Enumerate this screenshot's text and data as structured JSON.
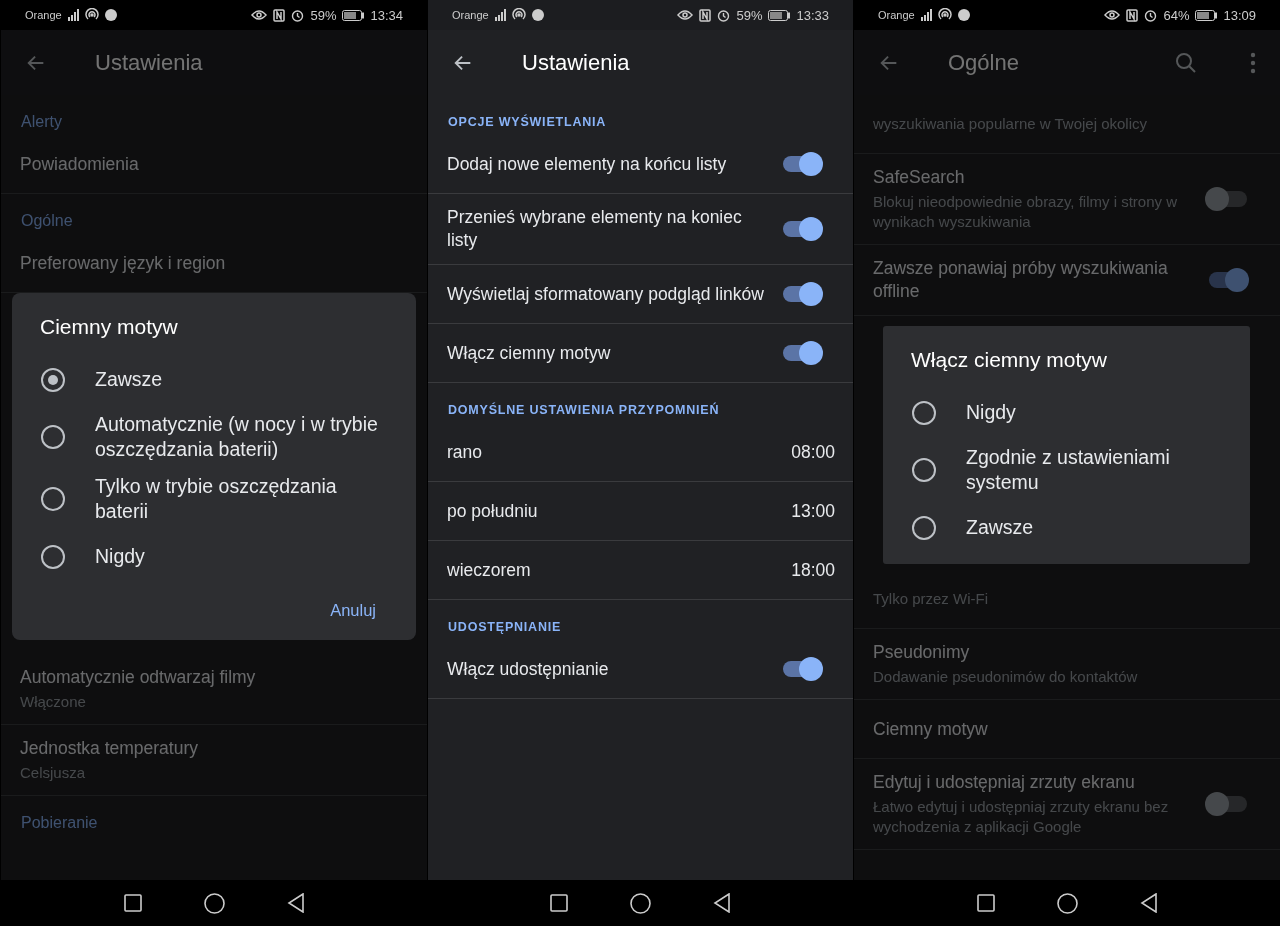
{
  "screens": [
    {
      "dimmed": true,
      "status_bar": {
        "carrier": "Orange",
        "battery": "59%",
        "time": "13:34"
      },
      "app_bar": {
        "title": "Ustawienia"
      },
      "items": [
        {
          "kind": "header",
          "label": "Alerty"
        },
        {
          "kind": "item",
          "title": "Powiadomienia"
        },
        {
          "kind": "header",
          "label": "Ogólne"
        },
        {
          "kind": "item",
          "title": "Preferowany język i region"
        },
        {
          "kind": "dialog",
          "title": "Ciemny motyw",
          "options": [
            {
              "label": "Zawsze",
              "selected": true
            },
            {
              "label": "Automatycznie (w nocy i w trybie oszczędzania baterii)",
              "selected": false
            },
            {
              "label": "Tylko w trybie oszczędzania baterii",
              "selected": false
            },
            {
              "label": "Nigdy",
              "selected": false
            }
          ],
          "buttons": [
            "Anuluj"
          ]
        },
        {
          "kind": "item",
          "title": "Automatycznie odtwarzaj filmy",
          "subtitle": "Włączone"
        },
        {
          "kind": "item",
          "title": "Jednostka temperatury",
          "subtitle": "Celsjusza"
        },
        {
          "kind": "header",
          "label": "Pobieranie"
        }
      ]
    },
    {
      "dimmed": false,
      "status_bar": {
        "carrier": "Orange",
        "battery": "59%",
        "time": "13:33"
      },
      "app_bar": {
        "title": "Ustawienia"
      },
      "items": [
        {
          "kind": "caps_header",
          "label": "OPCJE WYŚWIETLANIA"
        },
        {
          "kind": "toggle",
          "title": "Dodaj nowe elementy na końcu listy",
          "on": true
        },
        {
          "kind": "toggle",
          "title": "Przenieś wybrane elementy na koniec listy",
          "on": true
        },
        {
          "kind": "toggle",
          "title": "Wyświetlaj sformatowany podgląd linków",
          "on": true
        },
        {
          "kind": "toggle",
          "title": "Włącz ciemny motyw",
          "on": true
        },
        {
          "kind": "caps_header",
          "label": "DOMYŚLNE USTAWIENIA PRZYPOMNIEŃ"
        },
        {
          "kind": "value",
          "title": "rano",
          "value": "08:00"
        },
        {
          "kind": "value",
          "title": "po południu",
          "value": "13:00"
        },
        {
          "kind": "value",
          "title": "wieczorem",
          "value": "18:00"
        },
        {
          "kind": "caps_header",
          "label": "UDOSTĘPNIANIE"
        },
        {
          "kind": "toggle",
          "title": "Włącz udostępnianie",
          "on": true
        }
      ]
    },
    {
      "dimmed": true,
      "status_bar": {
        "carrier": "Orange",
        "battery": "64%",
        "time": "13:09"
      },
      "app_bar": {
        "title": "Ogólne",
        "actions": [
          {
            "kind": "search"
          },
          {
            "kind": "menu"
          }
        ]
      },
      "items": [
        {
          "kind": "item",
          "subtitle": "wyszukiwania popularne w Twojej okolicy"
        },
        {
          "kind": "toggle",
          "title": "SafeSearch",
          "subtitle": "Blokuj nieodpowiednie obrazy, filmy i strony w wynikach wyszukiwania",
          "on": false
        },
        {
          "kind": "toggle",
          "title": "Zawsze ponawiaj próby wyszukiwania offline",
          "on": true
        },
        {
          "kind": "dialog",
          "title": "Włącz ciemny motyw",
          "options": [
            {
              "label": "Nigdy",
              "selected": false
            },
            {
              "label": "Zgodnie z ustawieniami systemu",
              "selected": false
            },
            {
              "label": "Zawsze",
              "selected": false
            }
          ]
        },
        {
          "kind": "item",
          "subtitle": "Tylko przez Wi-Fi"
        },
        {
          "kind": "item",
          "title": "Pseudonimy",
          "subtitle": "Dodawanie pseudonimów do kontaktów"
        },
        {
          "kind": "item",
          "title": "Ciemny motyw"
        },
        {
          "kind": "toggle",
          "title": "Edytuj i udostępniaj zrzuty ekranu",
          "subtitle": "Łatwo edytuj i udostępniaj zrzuty ekranu bez wychodzenia z aplikacji Google",
          "on": false
        }
      ]
    }
  ]
}
